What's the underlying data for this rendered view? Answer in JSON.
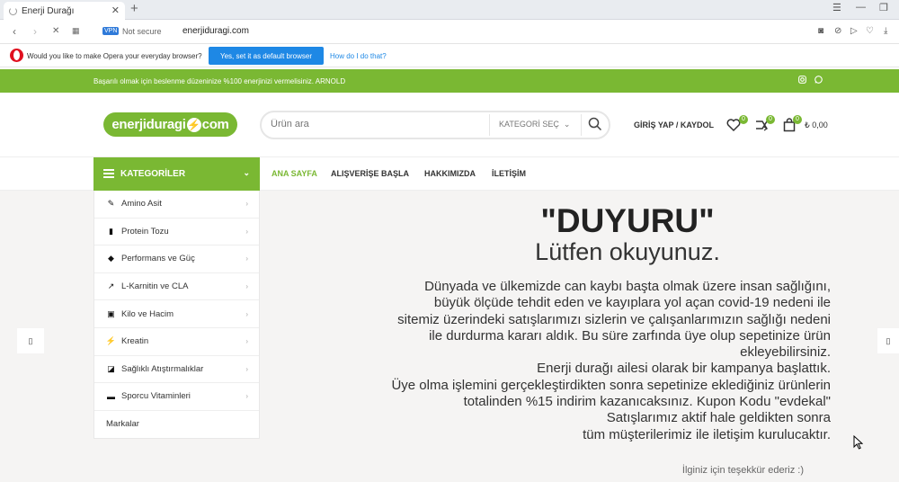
{
  "browser": {
    "tab_title": "Enerji Durağı",
    "security": "Not secure",
    "vpn": "VPN",
    "url": "enerjiduragi.com"
  },
  "opera": {
    "message": "Would you like to make Opera your everyday browser?",
    "yes_label": "Yes, set it as default browser",
    "how_label": "How do I do that?"
  },
  "topbar": {
    "message": "Başarılı olmak için beslenme düzeninize %100 enerjinizi vermelisiniz. ARNOLD"
  },
  "header": {
    "logo_left": "enerjiduragi",
    "logo_right": "com",
    "search_placeholder": "Ürün ara",
    "category_select": "KATEGORİ SEÇ",
    "login": "GİRİŞ YAP / KAYDOL",
    "wishlist_count": "0",
    "compare_count": "0",
    "cart_count": "0",
    "cart_total": "₺ 0,00"
  },
  "nav": {
    "categories_label": "KATEGORİLER",
    "links": [
      "ANA SAYFA",
      "ALIŞVERİŞE BAŞLA",
      "HAKKIMIZDA",
      "İLETİŞİM"
    ]
  },
  "sidebar": {
    "items": [
      {
        "label": "Amino Asit",
        "icon": "amino-icon"
      },
      {
        "label": "Protein Tozu",
        "icon": "protein-jar-icon"
      },
      {
        "label": "Performans ve Güç",
        "icon": "performance-icon"
      },
      {
        "label": "L-Karnitin ve CLA",
        "icon": "carnitine-icon"
      },
      {
        "label": "Kilo ve Hacim",
        "icon": "weight-bag-icon"
      },
      {
        "label": "Kreatin",
        "icon": "bolt-icon"
      },
      {
        "label": "Sağlıklı Atıştırmalıklar",
        "icon": "snack-icon"
      },
      {
        "label": "Sporcu Vitaminleri",
        "icon": "vitamin-icon"
      }
    ],
    "brands_label": "Markalar"
  },
  "announcement": {
    "title": "\"DUYURU\"",
    "subtitle": "Lütfen okuyunuz.",
    "lines": [
      "Dünyada ve ülkemizde can kaybı başta olmak üzere insan sağlığını,",
      "büyük ölçüde tehdit eden ve kayıplara yol açan covid-19 nedeni ile",
      "sitemiz üzerindeki satışlarımızı sizlerin ve çalışanlarımızın sağlığı nedeni",
      "ile durdurma kararı aldık. Bu süre zarfında üye olup sepetinize ürün",
      "ekleyebilirsiniz.",
      "Enerji durağı ailesi olarak bir kampanya başlattık.",
      "Üye olma işlemini gerçekleştirdikten sonra sepetinize eklediğiniz ürünlerin",
      "totalinden %15 indirim kazanıcaksınız. Kupon Kodu \"evdekal\"",
      "Satışlarımız aktif hale geldikten sonra",
      "tüm müşterilerimiz ile iletişim kurulucaktır."
    ],
    "thanks": "İlginiz için teşekkür ederiz :)"
  },
  "colors": {
    "brand_green": "#7ab833",
    "opera_blue": "#1e88e5",
    "content_bg": "#f5f4f3"
  }
}
